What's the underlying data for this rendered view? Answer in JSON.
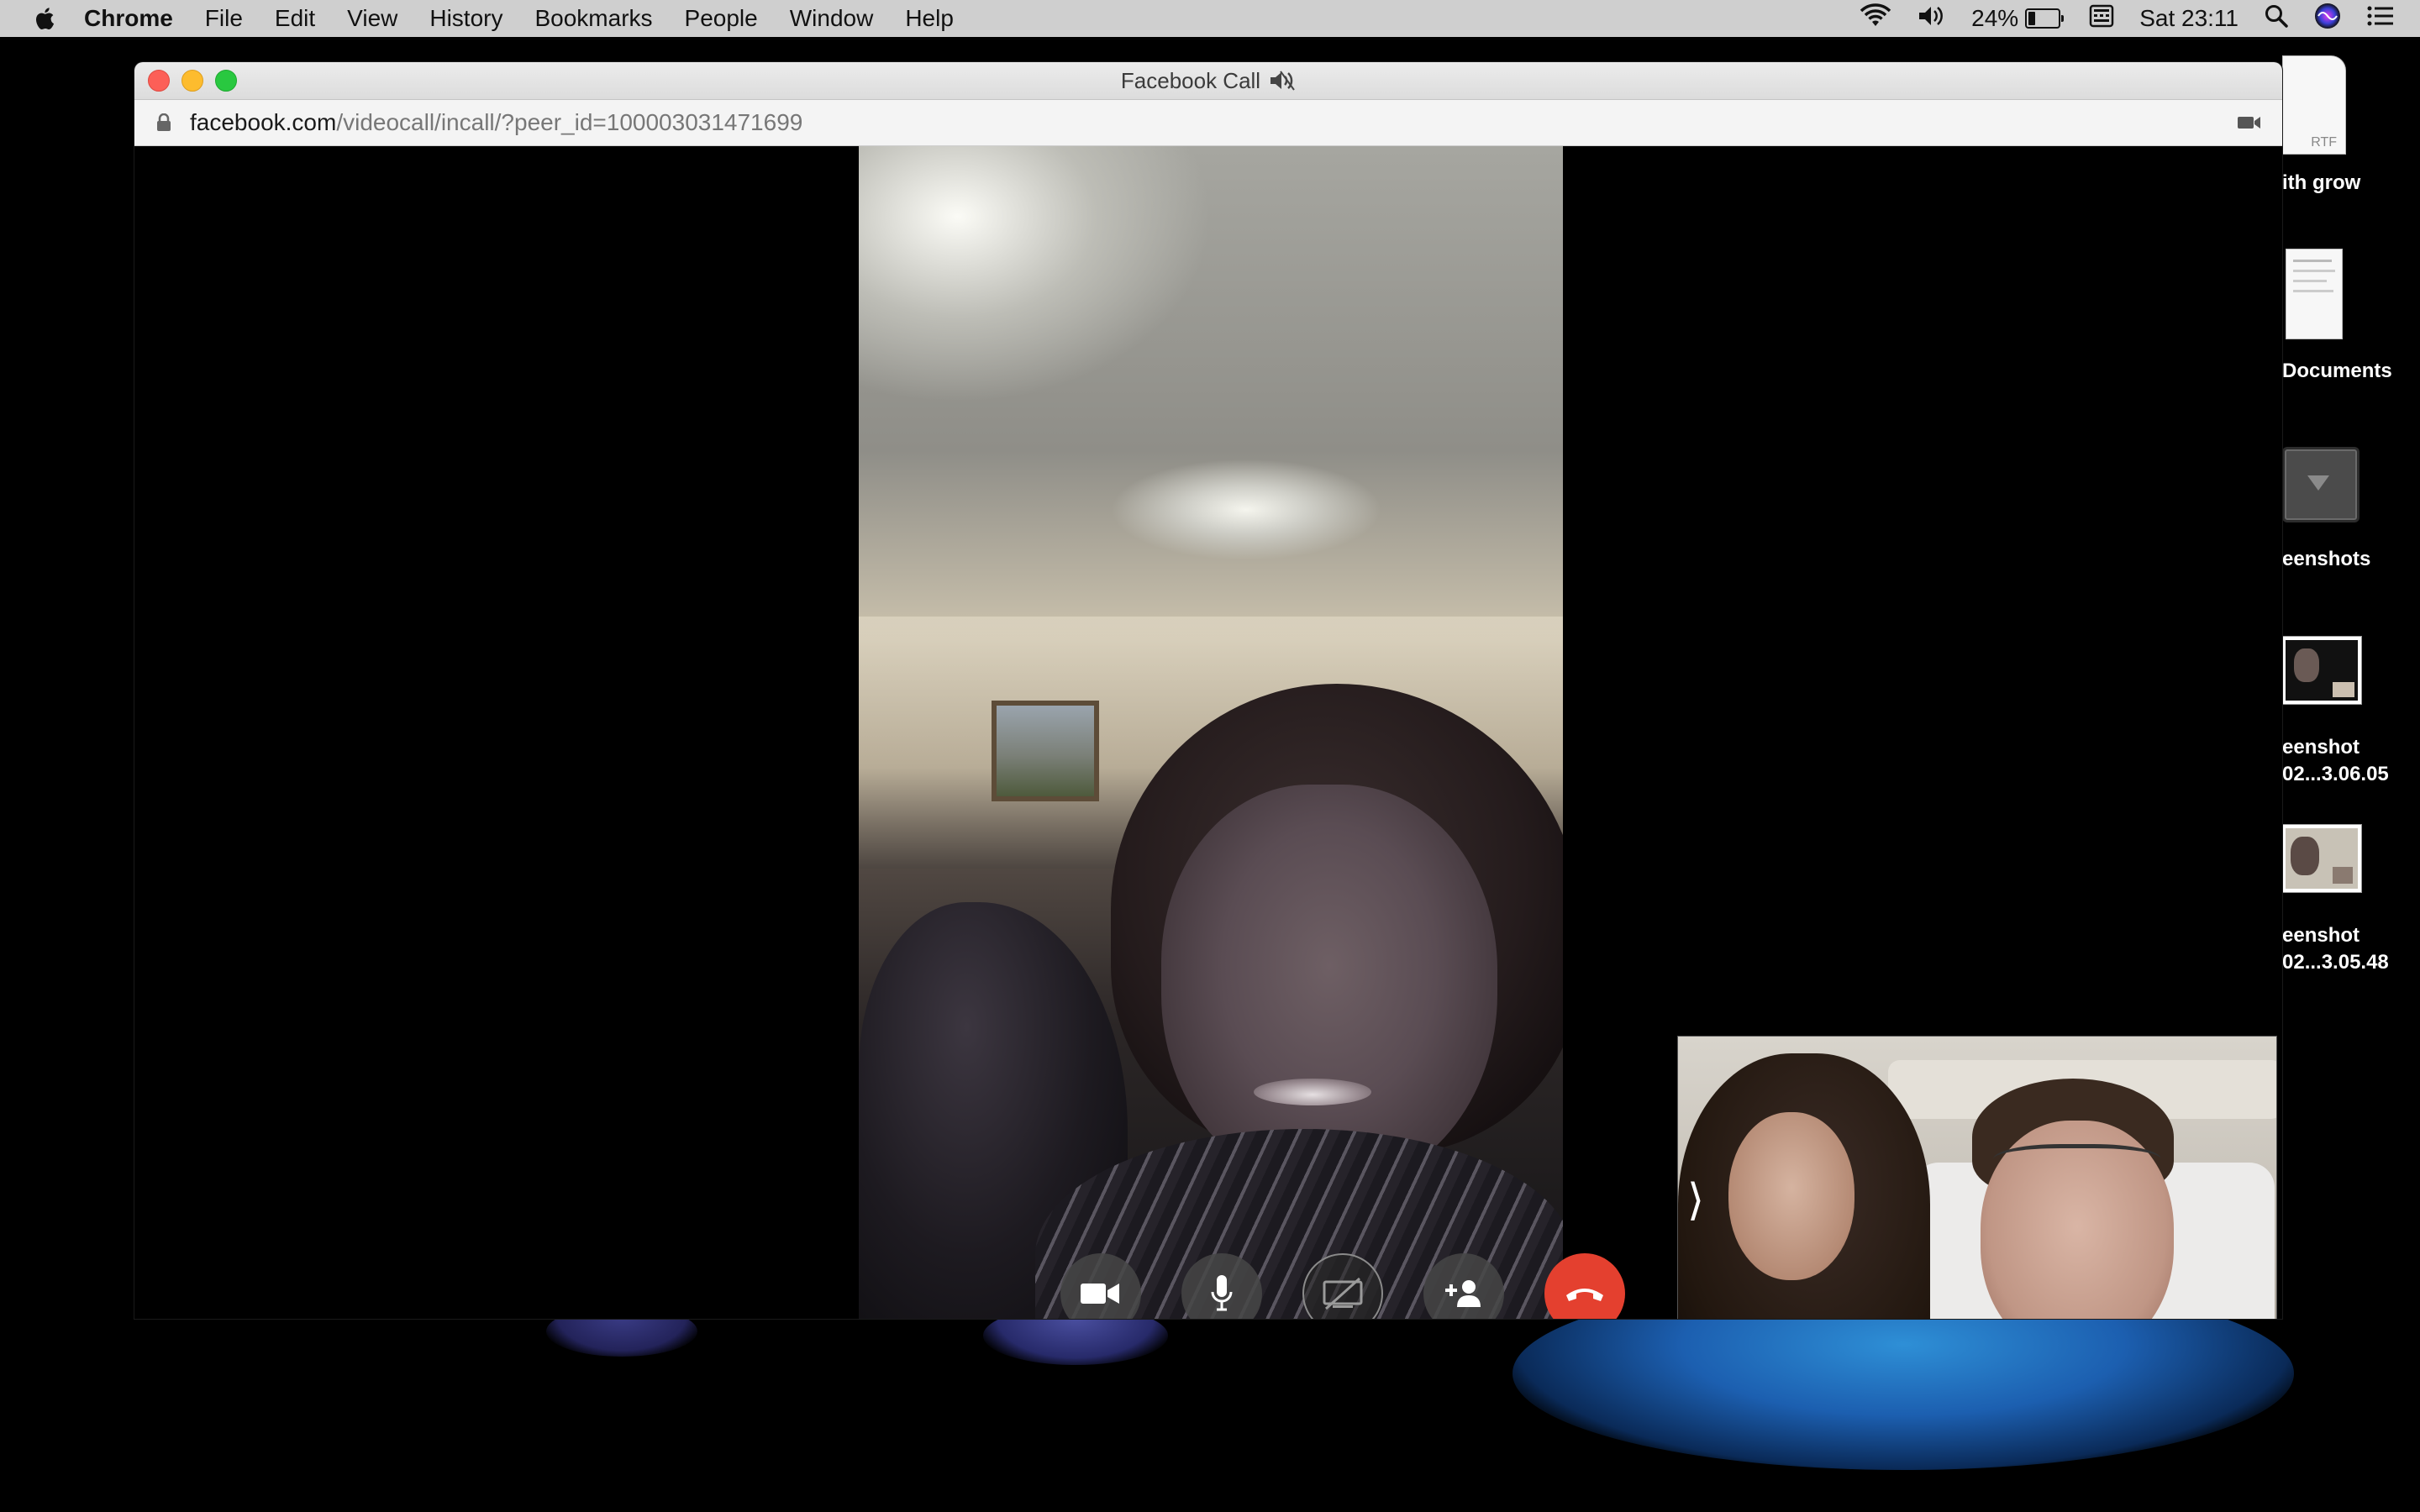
{
  "menubar": {
    "app_name": "Chrome",
    "menus": [
      "File",
      "Edit",
      "View",
      "History",
      "Bookmarks",
      "People",
      "Window",
      "Help"
    ],
    "battery_percent": "24%",
    "battery_level": 0.24,
    "clock": "Sat 23:11"
  },
  "window": {
    "title": "Facebook Call",
    "url_host": "facebook.com",
    "url_path": "/videocall/incall/?peer_id=100003031471699"
  },
  "desktop": {
    "items": [
      {
        "label": "ith grow",
        "badge": "RTF"
      },
      {
        "label": "Documents"
      },
      {
        "label": "eenshots"
      },
      {
        "label_line1": "eenshot",
        "label_line2": "02...3.06.05"
      },
      {
        "label_line1": "eenshot",
        "label_line2": "02...3.05.48"
      }
    ]
  },
  "call": {
    "self_view_toggle": "⟩",
    "controls": [
      "camera-toggle",
      "microphone",
      "screen-share",
      "add-person",
      "end-call"
    ]
  },
  "colors": {
    "end_call": "#e4402f",
    "control_bg": "#464646",
    "menubar_bg": "#cfcfcf"
  }
}
